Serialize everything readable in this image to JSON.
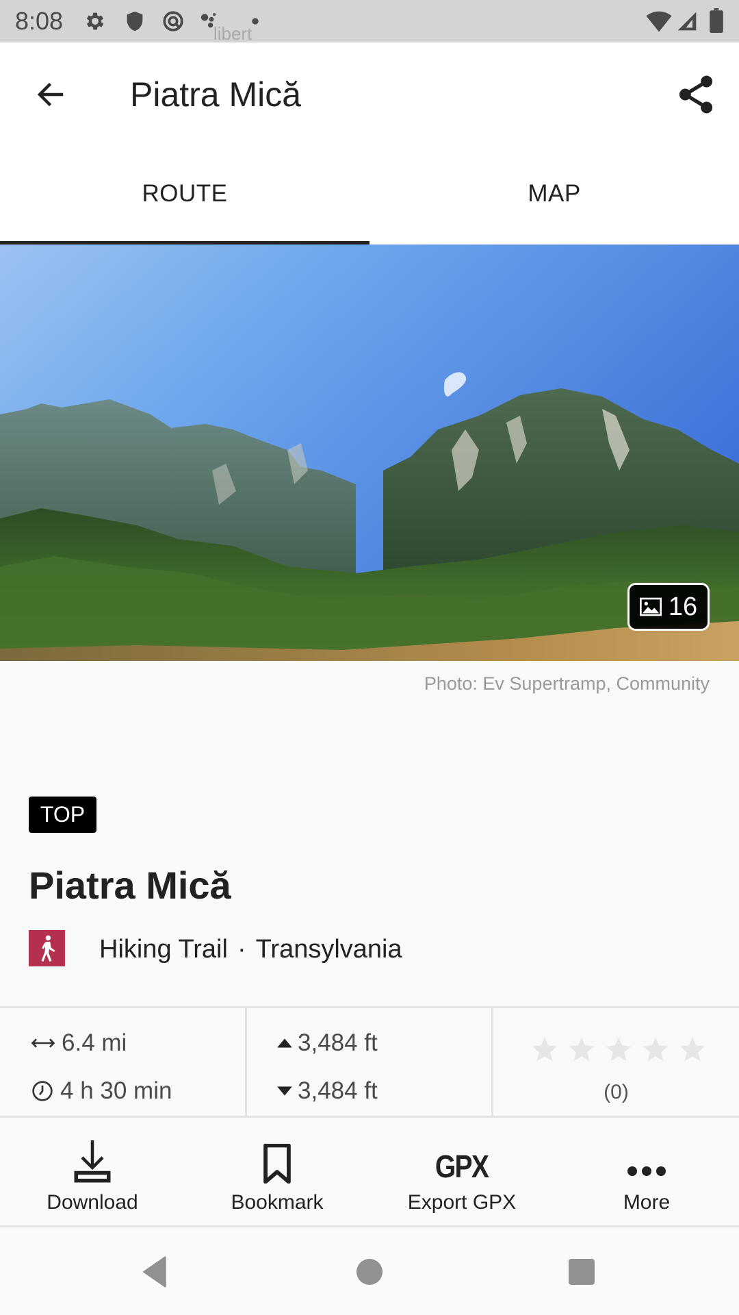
{
  "status_bar": {
    "time": "8:08",
    "overlay_text": "libert",
    "icons": [
      "settings-gear-icon",
      "shield-icon",
      "at-sign-icon",
      "dots-icon",
      "notification-dot-icon",
      "wifi-icon",
      "cell-signal-icon",
      "battery-icon"
    ]
  },
  "app_bar": {
    "title": "Piatra Mică",
    "back_icon": "arrow-left-icon",
    "share_icon": "share-icon"
  },
  "tabs": [
    {
      "label": "ROUTE",
      "selected": true
    },
    {
      "label": "MAP",
      "selected": false
    }
  ],
  "photo": {
    "photo_count": "16",
    "photo_icon": "image-icon",
    "credit": "Photo: Ev Supertramp, Community"
  },
  "route": {
    "badge": "TOP",
    "title": "Piatra Mică",
    "category": "Hiking Trail",
    "separator": "·",
    "region": "Transylvania",
    "category_icon": "hiking-icon",
    "category_color": "#b3304f"
  },
  "stats": {
    "distance": "6.4 mi",
    "duration": "4 h 30 min",
    "ascent": "3,484 ft",
    "descent": "3,484 ft",
    "rating_stars_filled": 0,
    "rating_stars_total": 5,
    "rating_count": "(0)"
  },
  "actions": [
    {
      "label": "Download",
      "icon": "download-icon"
    },
    {
      "label": "Bookmark",
      "icon": "bookmark-icon"
    },
    {
      "label": "Export GPX",
      "icon": "gpx-icon",
      "glyph": "GPX"
    },
    {
      "label": "More",
      "icon": "more-horizontal-icon"
    }
  ],
  "nav_bar": {
    "buttons": [
      "back",
      "home",
      "recents"
    ]
  }
}
